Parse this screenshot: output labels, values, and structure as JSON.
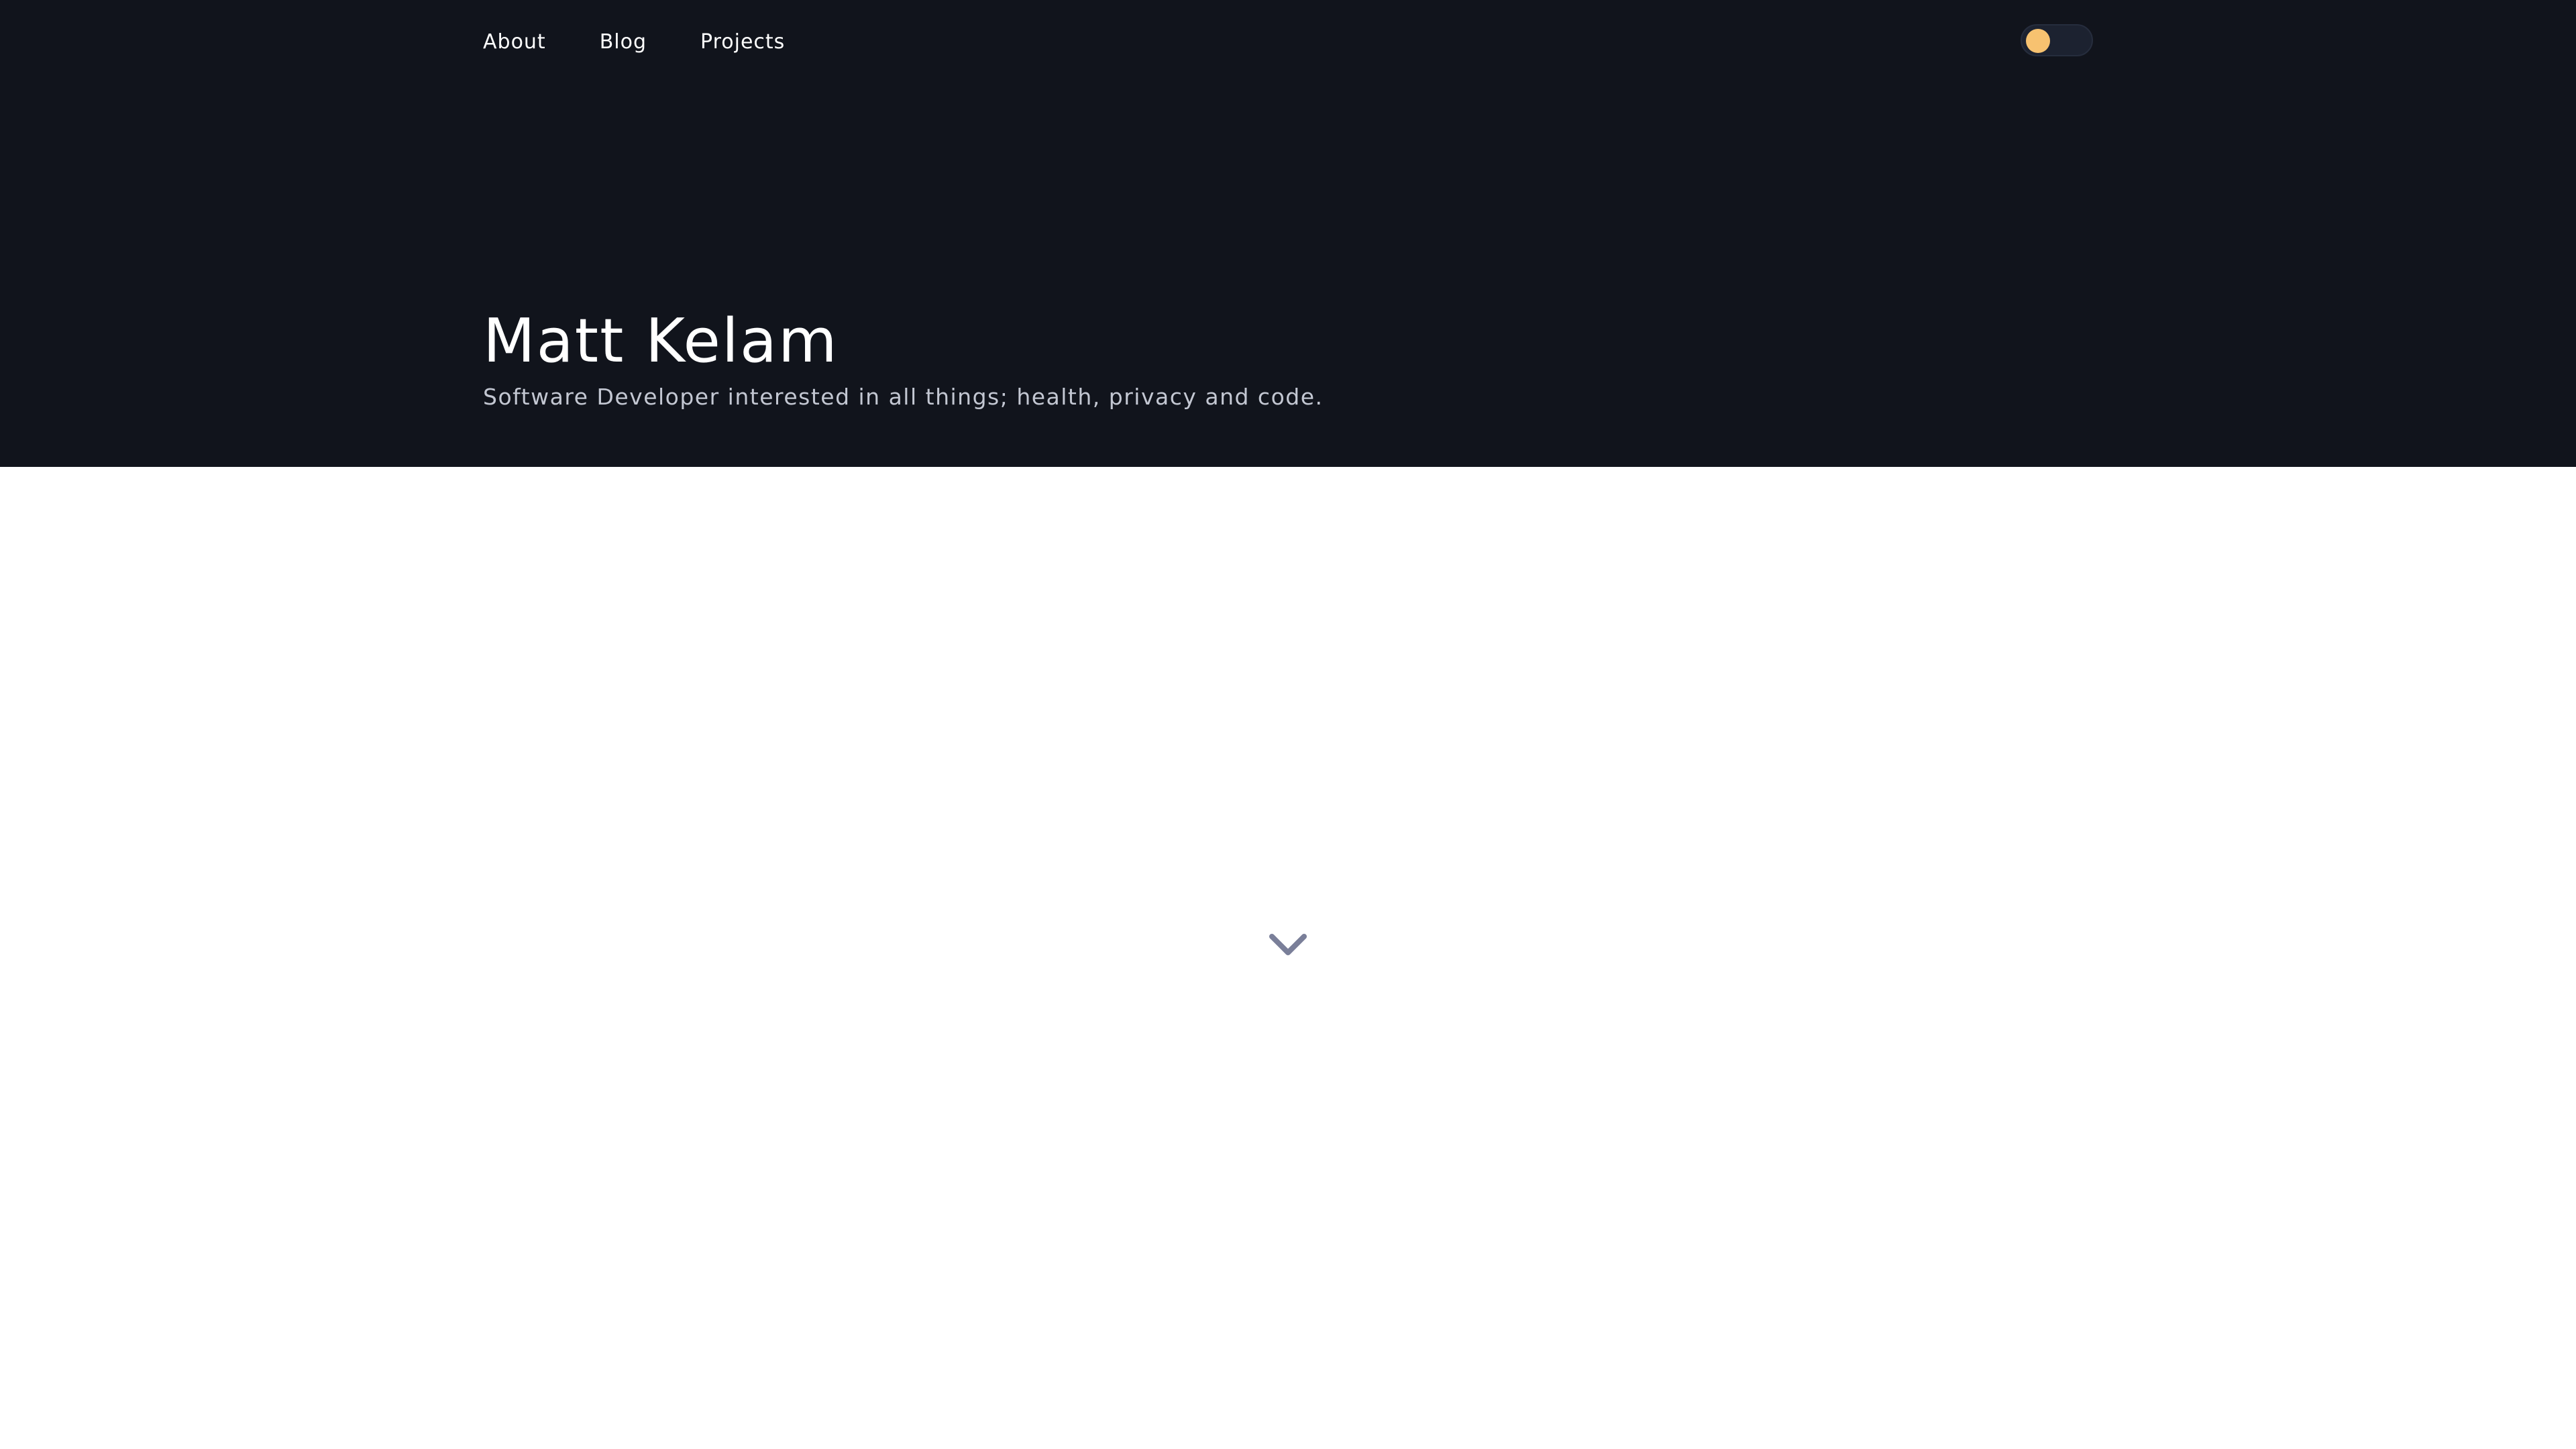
{
  "nav": {
    "items": [
      {
        "label": "About"
      },
      {
        "label": "Blog"
      },
      {
        "label": "Projects"
      }
    ]
  },
  "theme_toggle": {
    "knob_color": "#f7c270",
    "track_color": "#1c2230"
  },
  "hero": {
    "title": "Matt Kelam",
    "subtitle": "Software Developer interested in all things; health, privacy and code.",
    "background_color": "#11141c"
  },
  "scroll_indicator": {
    "icon": "chevron-down-icon",
    "color": "#7a7f99"
  }
}
